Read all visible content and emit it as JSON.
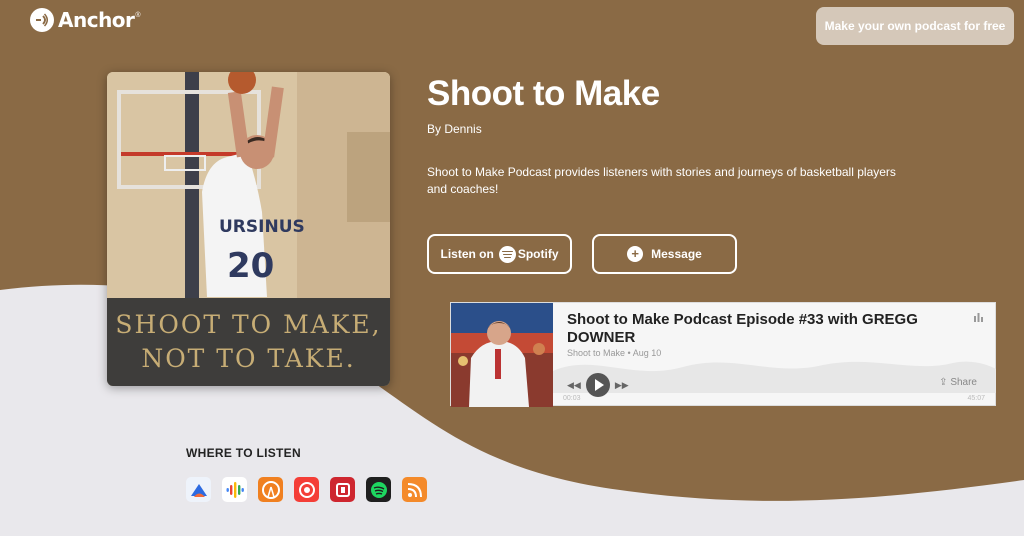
{
  "brand": {
    "name": "Anchor",
    "mark": "®",
    "colors": {
      "header": "#8a6a45",
      "light": "#e9e8ec",
      "cover_text": "#c7ad75"
    }
  },
  "header": {
    "cta_label": "Make your own podcast for free"
  },
  "podcast": {
    "cover_line1": "SHOOT TO MAKE,",
    "cover_line2": "NOT TO TAKE.",
    "jersey": "URSINUS",
    "jersey_number": "20",
    "title": "Shoot to Make",
    "author": "By Dennis",
    "description": "Shoot to Make Podcast provides listeners with stories and journeys of basketball players and coaches!"
  },
  "buttons": {
    "listen_prefix": "Listen on",
    "spotify_label": "Spotify",
    "message_label": "Message"
  },
  "player": {
    "episode_title": "Shoot to Make Podcast Episode #33 with GREGG DOWNER",
    "meta": "Shoot to Make • Aug 10",
    "share_label": "Share",
    "time_start": "00:03",
    "time_end": "45:07"
  },
  "where_to_listen": {
    "heading": "WHERE TO LISTEN",
    "platforms": [
      {
        "name": "breaker-icon",
        "color": "#2d6ae0"
      },
      {
        "name": "google-podcasts-icon",
        "color": "#ffffff"
      },
      {
        "name": "overcast-icon",
        "color": "#f08020"
      },
      {
        "name": "pocket-casts-icon",
        "color": "#f43e37"
      },
      {
        "name": "radiopublic-icon",
        "color": "#ce262f"
      },
      {
        "name": "spotify-icon",
        "color": "#1f1f1f"
      },
      {
        "name": "rss-icon",
        "color": "#f48a2a"
      }
    ]
  }
}
